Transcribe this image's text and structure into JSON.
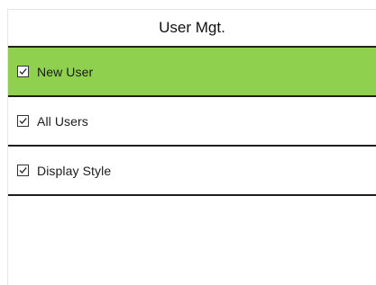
{
  "title": "User Mgt.",
  "menu": {
    "items": [
      {
        "label": "New User",
        "checked": true,
        "selected": true,
        "icon": "checkbox-checked-icon"
      },
      {
        "label": "All Users",
        "checked": true,
        "selected": false,
        "icon": "checkbox-checked-icon"
      },
      {
        "label": "Display Style",
        "checked": true,
        "selected": false,
        "icon": "checkbox-checked-icon"
      }
    ]
  },
  "colors": {
    "selected_bg": "#8fd14f",
    "separator": "#1e1e1e",
    "background": "#ffffff"
  }
}
